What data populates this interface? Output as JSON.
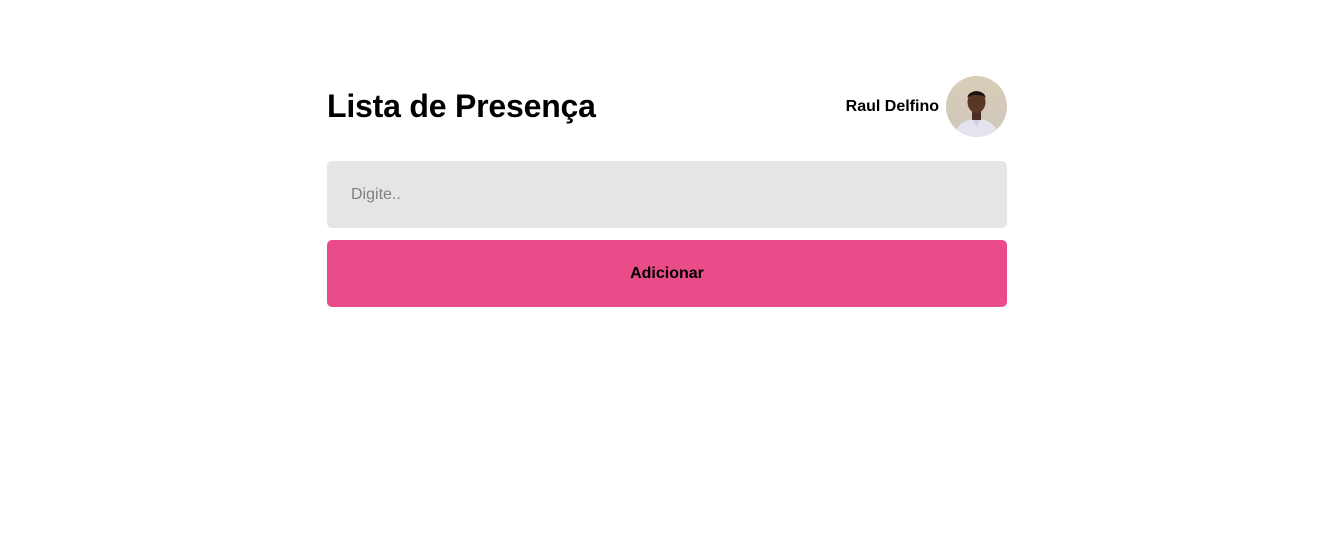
{
  "header": {
    "title": "Lista de Presença"
  },
  "user": {
    "name": "Raul Delfino",
    "avatar_icon": "user-photo-avatar"
  },
  "form": {
    "input_placeholder": "Digite..",
    "input_value": "",
    "add_button_label": "Adicionar"
  },
  "colors": {
    "accent": "#ea4c89",
    "input_background": "#e5e5e5",
    "page_background": "#ffffff"
  }
}
